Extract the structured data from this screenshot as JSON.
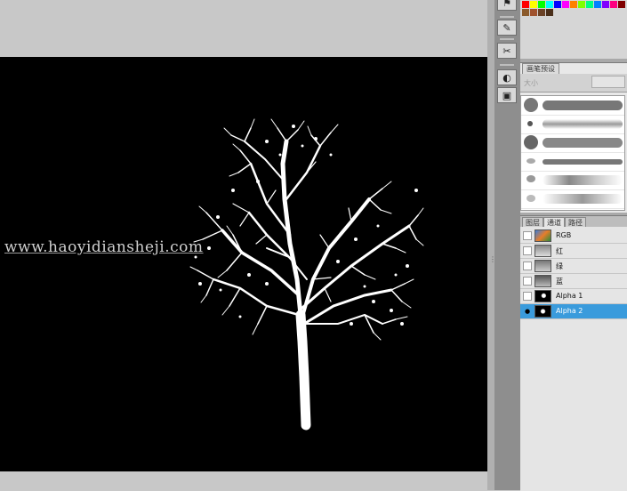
{
  "watermark": "www.haoyidiansheji.com",
  "colors": {
    "canvas": "#000000",
    "selection": "#3a9bdc",
    "workspace": "#c8c8c8"
  },
  "toolbar_icons": [
    "flag-icon",
    "brush-icon",
    "clone-stamp-icon",
    "toggle-mask-icon",
    "frame-icon"
  ],
  "brush_panel": {
    "tab_label": "画笔预设",
    "size_label": "大小"
  },
  "channels_panel": {
    "tabs": [
      "图层",
      "通道",
      "路径"
    ],
    "active_tab": "通道",
    "channels": [
      {
        "name": "RGB"
      },
      {
        "name": "红"
      },
      {
        "name": "绿"
      },
      {
        "name": "蓝"
      },
      {
        "name": "Alpha 1"
      },
      {
        "name": "Alpha 2",
        "selected": true,
        "visible": true
      }
    ]
  }
}
